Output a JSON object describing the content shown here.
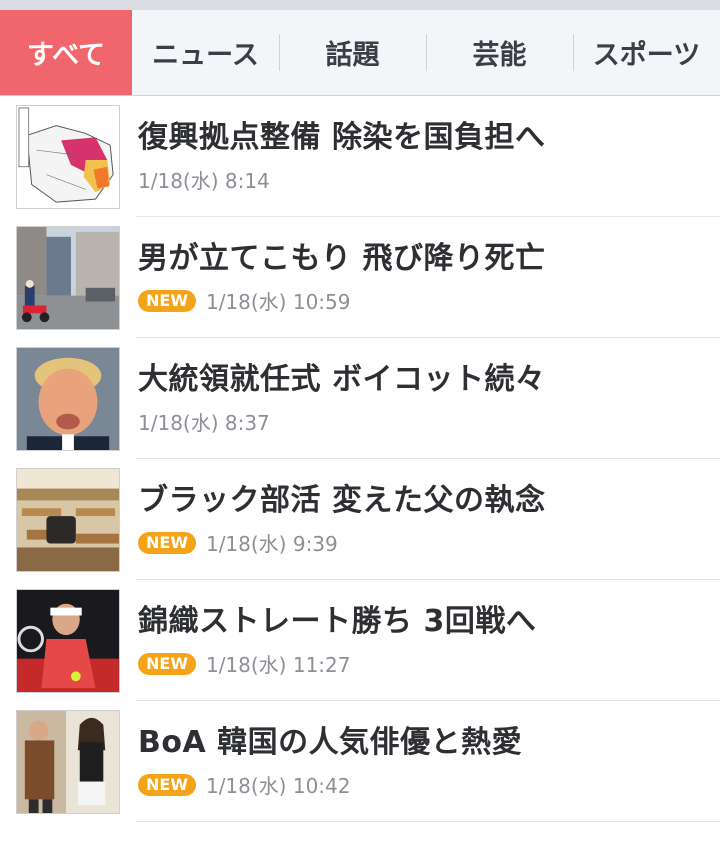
{
  "tabs": [
    {
      "label": "すべて",
      "active": true
    },
    {
      "label": "ニュース",
      "active": false
    },
    {
      "label": "話題",
      "active": false
    },
    {
      "label": "芸能",
      "active": false
    },
    {
      "label": "スポーツ",
      "active": false
    }
  ],
  "colors": {
    "active_tab": "#f0666c",
    "new_badge": "#f5a41a",
    "title_text": "#2d2f33",
    "date_text": "#8c9096"
  },
  "articles": [
    {
      "title": "復興拠点整備 除染を国負担へ",
      "date": "1/18(水) 8:14",
      "new": false,
      "thumb": "map-thumbnail"
    },
    {
      "title": "男が立てこもり 飛び降り死亡",
      "date": "1/18(水) 10:59",
      "new": true,
      "new_label": "NEW",
      "thumb": "street-police-thumbnail"
    },
    {
      "title": "大統領就任式 ボイコット続々",
      "date": "1/18(水) 8:37",
      "new": false,
      "thumb": "portrait-thumbnail"
    },
    {
      "title": "ブラック部活 変えた父の執念",
      "date": "1/18(水) 9:39",
      "new": true,
      "new_label": "NEW",
      "thumb": "classroom-thumbnail"
    },
    {
      "title": "錦織ストレート勝ち 3回戦へ",
      "date": "1/18(水) 11:27",
      "new": true,
      "new_label": "NEW",
      "thumb": "tennis-thumbnail"
    },
    {
      "title": "BoA 韓国の人気俳優と熱愛",
      "date": "1/18(水) 10:42",
      "new": true,
      "new_label": "NEW",
      "thumb": "celebrities-thumbnail"
    }
  ]
}
